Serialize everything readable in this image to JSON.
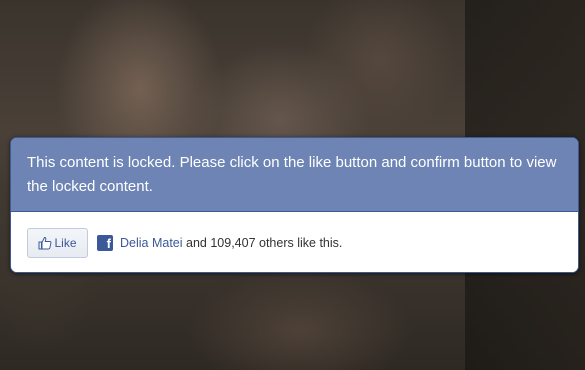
{
  "locker": {
    "message": "This content is locked. Please click on the like button and confirm button to view the locked content.",
    "like_button_label": "Like",
    "friend_name": "Delia Matei",
    "social_suffix": "and 109,407 others like this.",
    "icons": {
      "like": "thumbs-up-icon",
      "brand": "facebook-icon"
    },
    "colors": {
      "header_bg": "#6d84b4",
      "brand_blue": "#3b5998",
      "link": "#3b5998"
    }
  }
}
